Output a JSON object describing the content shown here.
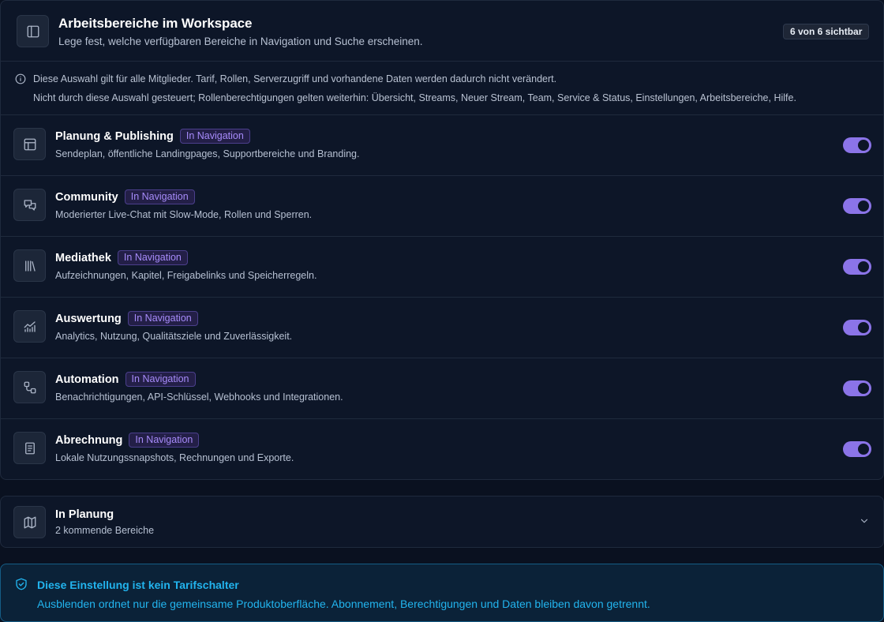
{
  "header": {
    "title": "Arbeitsbereiche im Workspace",
    "subtitle": "Lege fest, welche verfügbaren Bereiche in Navigation und Suche erscheinen.",
    "count_badge": "6 von 6 sichtbar",
    "icon": "sidebar-panel-icon"
  },
  "info": {
    "icon": "info-icon",
    "line1": "Diese Auswahl gilt für alle Mitglieder. Tarif, Rollen, Serverzugriff und vorhandene Daten werden dadurch nicht verändert.",
    "line2": "Nicht durch diese Auswahl gesteuert; Rollenberechtigungen gelten weiterhin: Übersicht, Streams, Neuer Stream, Team, Service & Status, Einstellungen, Arbeitsbereiche, Hilfe."
  },
  "modules": [
    {
      "title": "Planung & Publishing",
      "badge": "In Navigation",
      "description": "Sendeplan, öffentliche Landingpages, Supportbereiche und Branding.",
      "icon": "layout-icon",
      "enabled": true
    },
    {
      "title": "Community",
      "badge": "In Navigation",
      "description": "Moderierter Live-Chat mit Slow-Mode, Rollen und Sperren.",
      "icon": "chat-bubbles-icon",
      "enabled": true
    },
    {
      "title": "Mediathek",
      "badge": "In Navigation",
      "description": "Aufzeichnungen, Kapitel, Freigabelinks und Speicherregeln.",
      "icon": "library-icon",
      "enabled": true
    },
    {
      "title": "Auswertung",
      "badge": "In Navigation",
      "description": "Analytics, Nutzung, Qualitätsziele und Zuverlässigkeit.",
      "icon": "chart-icon",
      "enabled": true
    },
    {
      "title": "Automation",
      "badge": "In Navigation",
      "description": "Benachrichtigungen, API-Schlüssel, Webhooks und Integrationen.",
      "icon": "workflow-icon",
      "enabled": true
    },
    {
      "title": "Abrechnung",
      "badge": "In Navigation",
      "description": "Lokale Nutzungssnapshots, Rechnungen und Exporte.",
      "icon": "receipt-icon",
      "enabled": true
    }
  ],
  "planning": {
    "title": "In Planung",
    "subtitle": "2 kommende Bereiche",
    "icon": "map-icon",
    "chevron": "chevron-down-icon"
  },
  "notice": {
    "title": "Diese Einstellung ist kein Tarifschalter",
    "text": "Ausblenden ordnet nur die gemeinsame Produktoberfläche. Abonnement, Berechtigungen und Daten bleiben davon getrennt.",
    "icon": "shield-check-icon"
  },
  "colors": {
    "accent": "#8b74e8",
    "badge_text": "#a78bfa",
    "notice": "#22b4ee",
    "background": "#0a1120"
  }
}
